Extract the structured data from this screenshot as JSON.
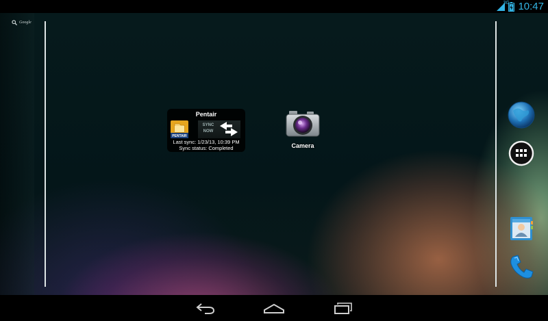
{
  "status_bar": {
    "network_type": "3G",
    "time": "10:47",
    "accent_color": "#33b5e5"
  },
  "search": {
    "label": "Google",
    "icon": "search-icon"
  },
  "pentair_widget": {
    "title": "Pentair",
    "logo_text": "PENTAIR",
    "sync_button_label": "SYNC\nNOW",
    "last_sync": "Last sync: 1/23/13, 10:39 PM",
    "sync_status": "Sync status: Completed"
  },
  "home_apps": [
    {
      "label": "Camera",
      "icon": "camera-icon"
    }
  ],
  "dock": [
    {
      "icon": "globe-icon"
    },
    {
      "icon": "all-apps-icon"
    },
    {
      "icon": "contacts-icon"
    },
    {
      "icon": "phone-icon"
    }
  ],
  "nav_bar": {
    "buttons": [
      "back-icon",
      "home-icon",
      "recents-icon"
    ]
  }
}
